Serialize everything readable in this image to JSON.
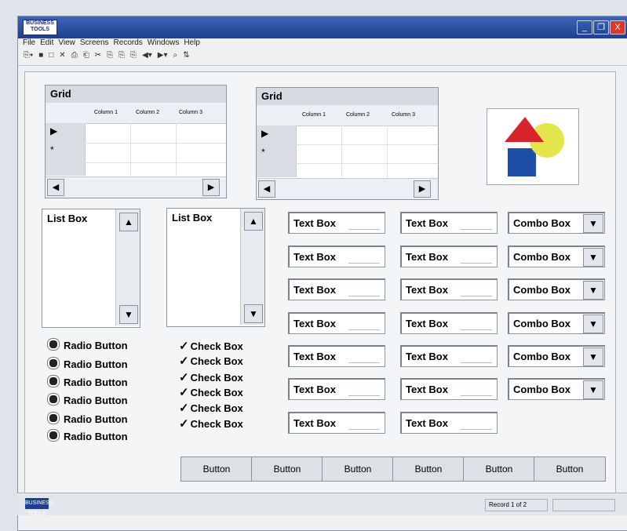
{
  "window": {
    "logo_text": "BUSINESS TOOLS",
    "controls": [
      "_",
      "❐",
      "X"
    ]
  },
  "menu": [
    "File",
    "Edit",
    "View",
    "Screens",
    "Records",
    "Windows",
    "Help"
  ],
  "toolbar": [
    "⎘▾",
    "■",
    "□",
    "✕",
    "⎙",
    "⎗",
    "✂",
    "⎘",
    "⎘",
    "⎘",
    "◀▾",
    "▶▾",
    "⌕",
    "⇅"
  ],
  "grids": [
    {
      "title": "Grid",
      "columns": [
        "Column 1",
        "Column 2",
        "Column 3"
      ],
      "row_markers": [
        "▶",
        "*"
      ],
      "scroll_left": "◀",
      "scroll_right": "▶"
    },
    {
      "title": "Grid",
      "columns": [
        "Column 1",
        "Column 2",
        "Column 3"
      ],
      "row_markers": [
        "▶",
        "*"
      ],
      "scroll_left": "◀",
      "scroll_right": "▶"
    }
  ],
  "list_boxes": [
    {
      "label": "List Box",
      "up": "▲",
      "down": "▼"
    },
    {
      "label": "List Box",
      "up": "▲",
      "down": "▼"
    }
  ],
  "text_boxes_col1": [
    "Text Box",
    "Text Box",
    "Text Box",
    "Text Box",
    "Text Box",
    "Text Box",
    "Text Box"
  ],
  "text_boxes_col2": [
    "Text Box",
    "Text Box",
    "Text Box",
    "Text Box",
    "Text Box",
    "Text Box",
    "Text Box"
  ],
  "combo_boxes": [
    "Combo Box",
    "Combo Box",
    "Combo Box",
    "Combo Box",
    "Combo Box",
    "Combo Box"
  ],
  "combo_arrow": "▼",
  "radio_buttons": [
    "Radio Button",
    "Radio Button",
    "Radio Button",
    "Radio Button",
    "Radio Button",
    "Radio Button"
  ],
  "check_boxes": [
    "Check Box",
    "Check Box",
    "Check Box",
    "Check Box",
    "Check Box",
    "Check Box"
  ],
  "check_glyph": "✓",
  "buttons": [
    "Button",
    "Button",
    "Button",
    "Button",
    "Button",
    "Button"
  ],
  "status": {
    "text": "Record 1 of 2"
  },
  "colors": {
    "title_bar": "#1f3f8f",
    "triangle": "#d9232c",
    "circle": "#e3e54a",
    "square": "#1e4fa8"
  }
}
